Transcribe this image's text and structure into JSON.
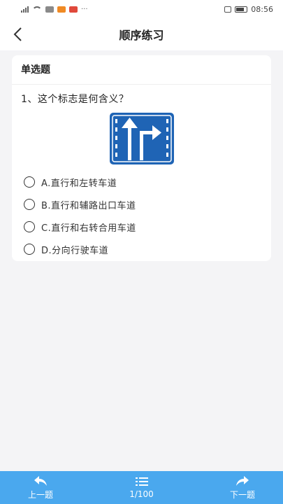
{
  "status_bar": {
    "time": "08:56"
  },
  "header": {
    "title": "顺序练习"
  },
  "question": {
    "type_label": "单选题",
    "text": "1、这个标志是何含义？",
    "options": [
      {
        "label": "A.直行和左转车道"
      },
      {
        "label": "B.直行和辅路出口车道"
      },
      {
        "label": "C.直行和右转合用车道"
      },
      {
        "label": "D.分向行驶车道"
      }
    ]
  },
  "footer": {
    "prev_label": "上一题",
    "progress": "1/100",
    "next_label": "下一题"
  },
  "colors": {
    "accent": "#4aa8ee",
    "sign_blue": "#1f64b5",
    "background": "#f4f4f6"
  }
}
